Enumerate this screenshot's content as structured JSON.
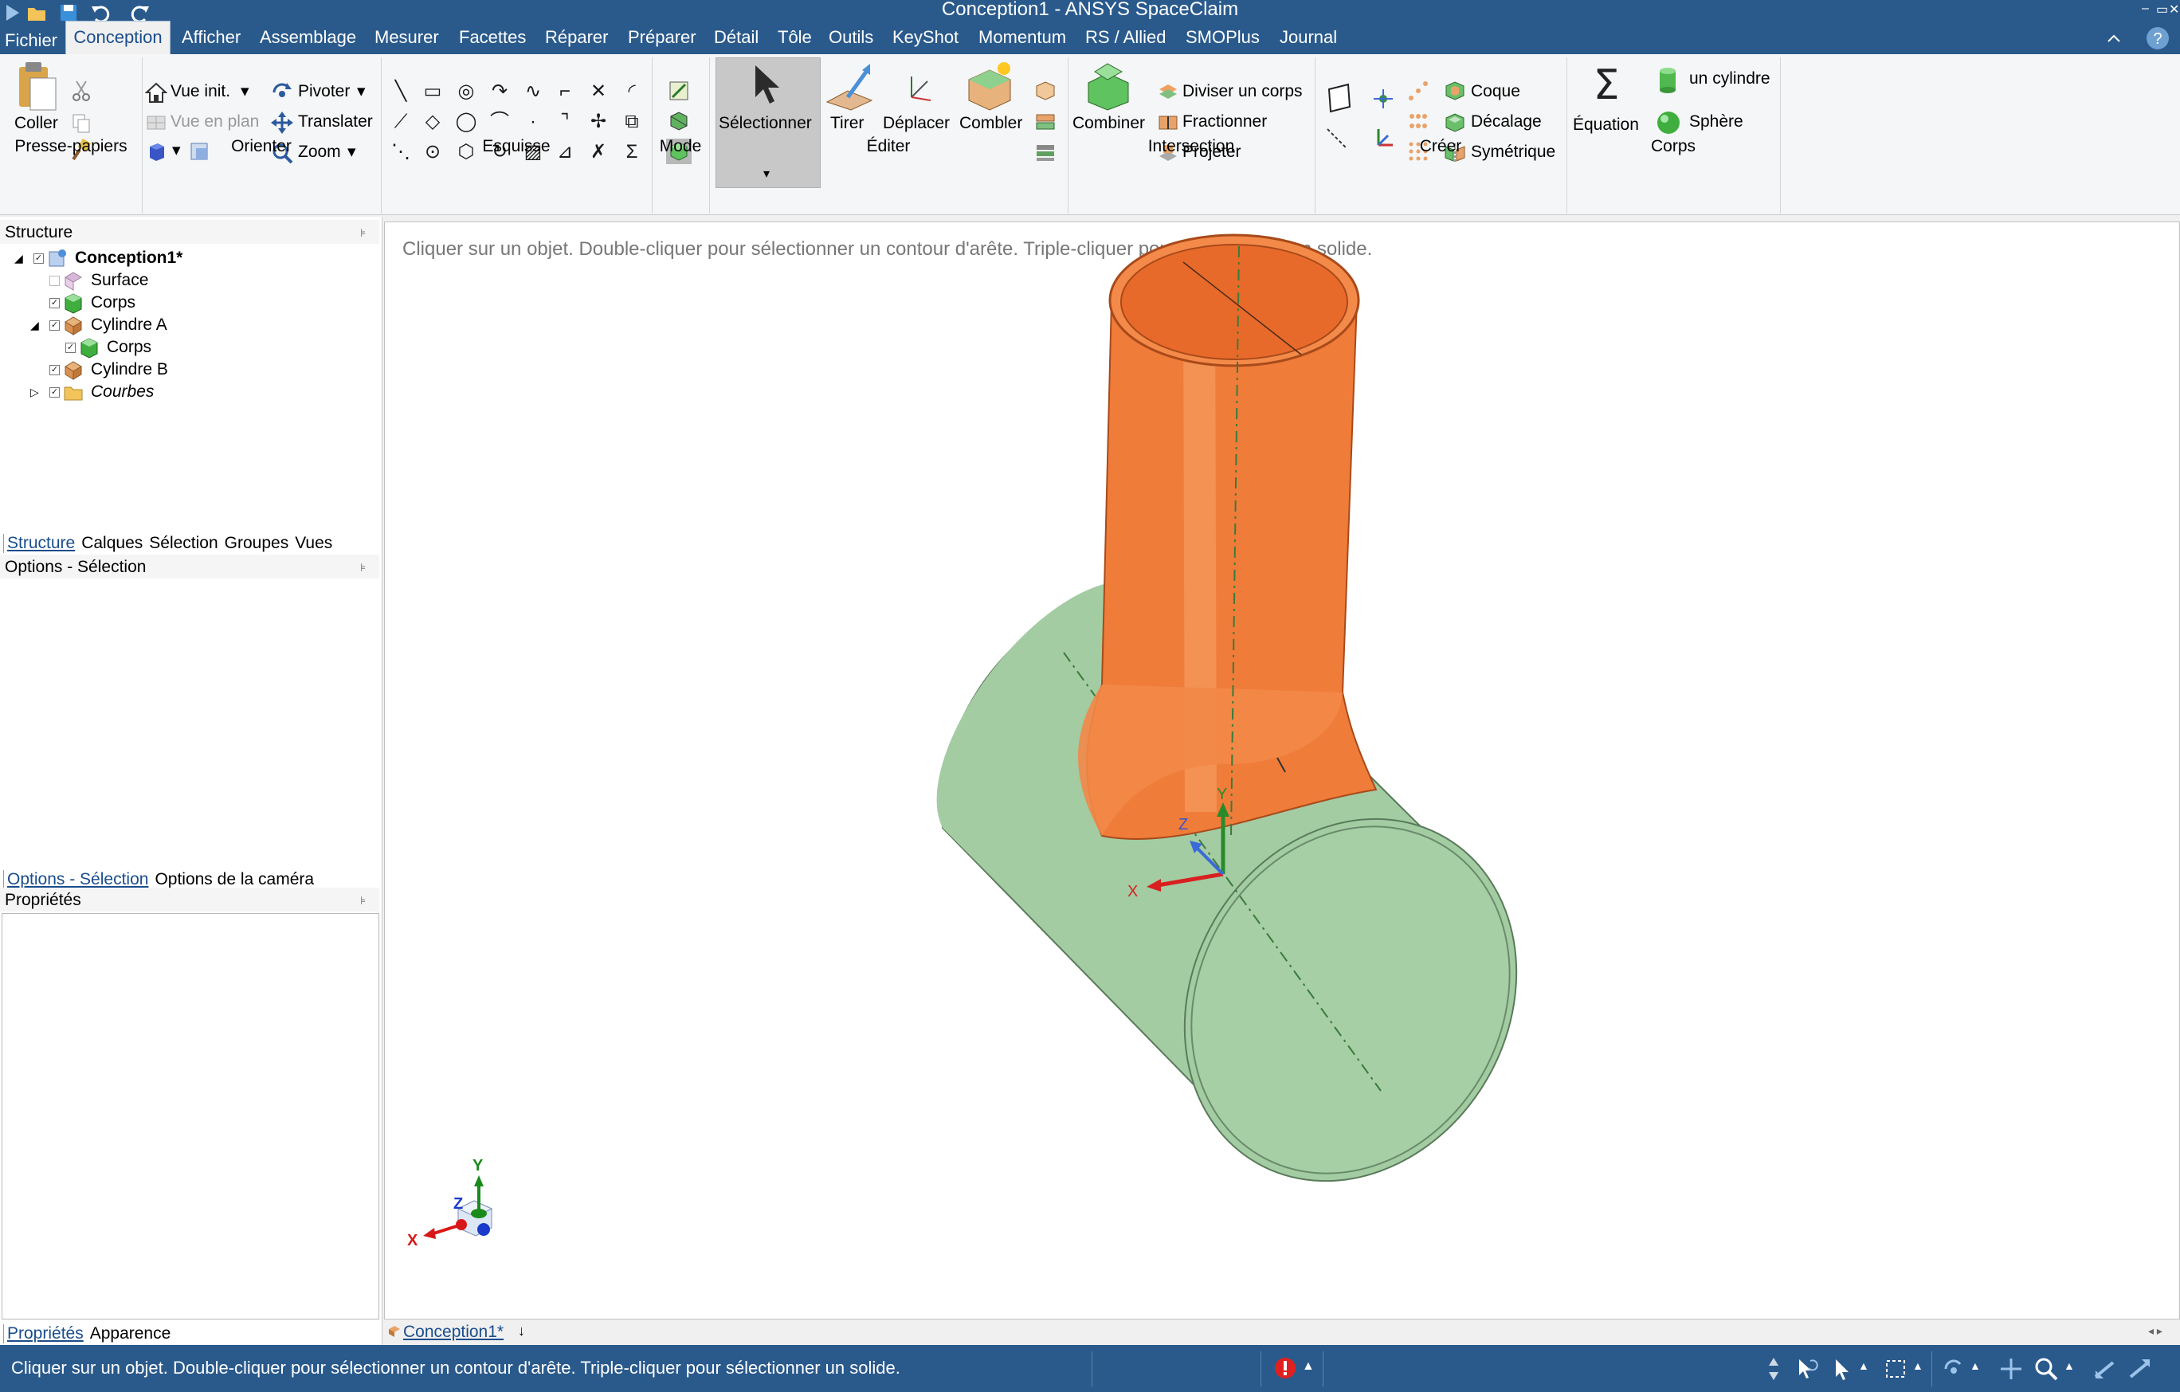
{
  "window": {
    "title": "Conception1 - ANSYS SpaceClaim",
    "controls": [
      "–",
      "▭",
      "✕"
    ]
  },
  "menu": {
    "file": "Fichier",
    "active": "Conception",
    "items": [
      "Afficher",
      "Assemblage",
      "Mesurer",
      "Facettes",
      "Réparer",
      "Préparer",
      "Détail",
      "Tôle",
      "Outils",
      "KeyShot",
      "Momentum",
      "RS / Allied",
      "SMOPlus",
      "Journal"
    ]
  },
  "ribbon": {
    "groups": {
      "clipboard": "Presse-papiers",
      "orient": "Orienter",
      "sketch": "Esquisse",
      "mode": "Mode",
      "edit": "Éditer",
      "intersection": "Intersection",
      "create": "Créer",
      "body": "Corps"
    },
    "clipboard": {
      "paste": "Coller"
    },
    "orient": {
      "home_view": "Vue init.",
      "plan_view": "Vue en plan",
      "pivot": "Pivoter",
      "translate": "Translater",
      "zoom": "Zoom"
    },
    "edit": {
      "select": "Sélectionner",
      "pull": "Tirer",
      "move": "Déplacer",
      "fill": "Combler"
    },
    "intersection": {
      "combine": "Combiner",
      "split_body": "Diviser un corps",
      "split": "Fractionner",
      "project": "Projeter"
    },
    "create": {
      "shell": "Coque",
      "offset": "Décalage",
      "mirror": "Symétrique"
    },
    "body": {
      "equation": "Équation",
      "cylinder": "un cylindre",
      "sphere": "Sphère"
    }
  },
  "structure": {
    "title": "Structure",
    "tree": [
      {
        "label": "Conception1*",
        "bold": true
      },
      {
        "label": "Surface"
      },
      {
        "label": "Corps"
      },
      {
        "label": "Cylindre A"
      },
      {
        "label": "Corps"
      },
      {
        "label": "Cylindre B"
      },
      {
        "label": "Courbes",
        "italic": true
      }
    ],
    "tabs": [
      "Structure",
      "Calques",
      "Sélection",
      "Groupes",
      "Vues"
    ]
  },
  "options": {
    "title": "Options - Sélection",
    "tabs": [
      "Options - Sélection",
      "Options de la caméra"
    ]
  },
  "properties": {
    "title": "Propriétés",
    "tabs": [
      "Propriétés",
      "Apparence"
    ]
  },
  "viewport": {
    "hint": "Cliquer sur un objet. Double-cliquer pour sélectionner un contour d'arête. Triple-cliquer pour sélectionner un solide.",
    "doc_tab": "Conception1*",
    "axes": {
      "x": "X",
      "y": "Y",
      "z": "Z"
    },
    "colors": {
      "cylinder_a": "#f07c3a",
      "cylinder_b": "#a3cca3",
      "bg": "#ffffff"
    }
  },
  "status": {
    "text": "Cliquer sur un objet. Double-cliquer pour sélectionner un contour d'arête. Triple-cliquer pour sélectionner un solide."
  },
  "colors": {
    "titlebar": "#2a5a8c",
    "ribbon": "#f5f6f7",
    "accent": "#1a4d8c"
  }
}
